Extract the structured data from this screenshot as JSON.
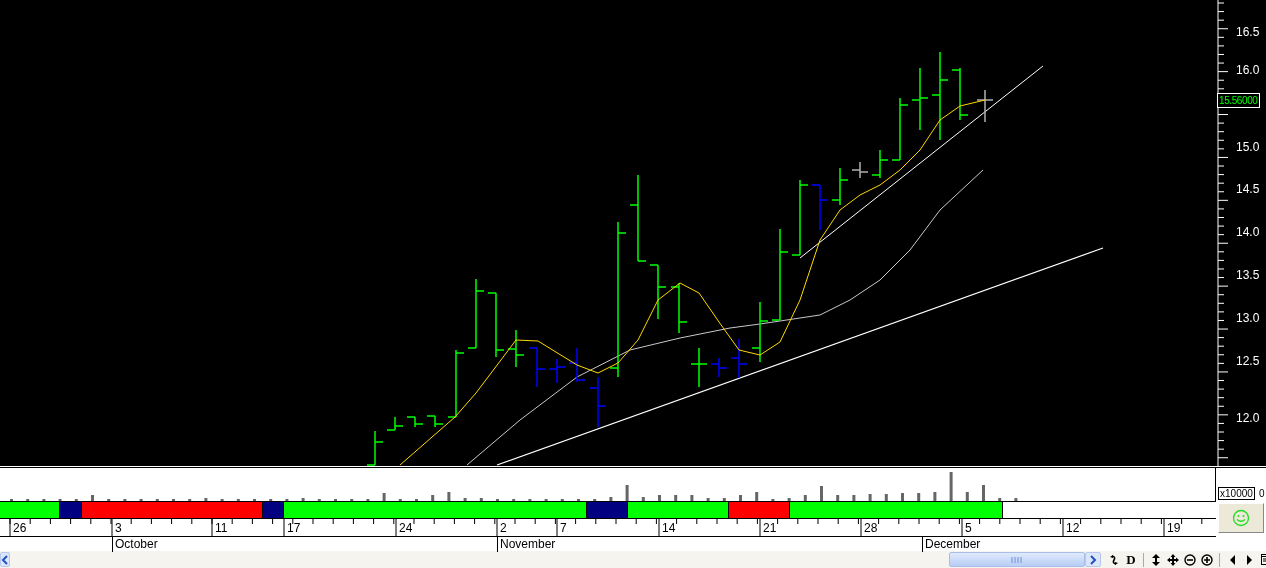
{
  "price_axis": {
    "ticks": [
      "16.5",
      "16.0",
      "15.0",
      "14.5",
      "14.0",
      "13.5",
      "13.0",
      "12.5",
      "12.0"
    ],
    "last_price": "15.56000"
  },
  "volume_axis": {
    "scale": "x10000",
    "tail": "0"
  },
  "signal_bands": [
    {
      "color": "#00ff00"
    },
    {
      "color": "#000080"
    },
    {
      "color": "#ff0000"
    },
    {
      "color": "#000080"
    },
    {
      "color": "#00ff00"
    },
    {
      "color": "#000080"
    },
    {
      "color": "#00ff00"
    },
    {
      "color": "#ff0000"
    },
    {
      "color": "#00ff00"
    }
  ],
  "date_axis": {
    "days": [
      "26",
      "3",
      "11",
      "17",
      "24",
      "2",
      "7",
      "14",
      "21",
      "28",
      "5",
      "12",
      "19"
    ],
    "months": [
      "October",
      "November",
      "December"
    ]
  },
  "toolbar": {
    "period_label": "D"
  }
}
